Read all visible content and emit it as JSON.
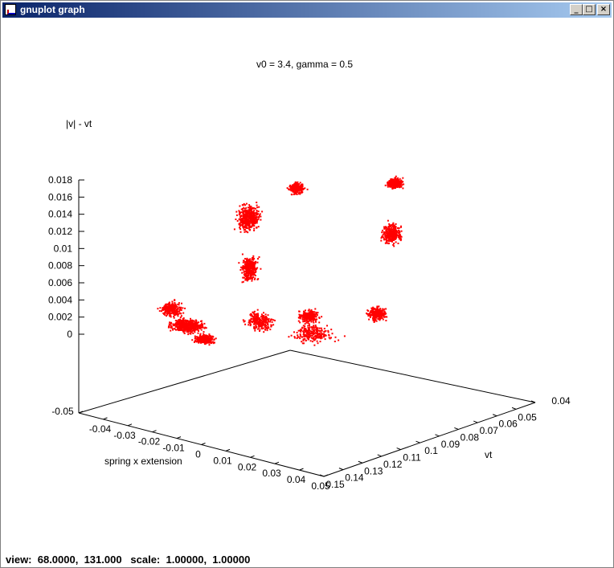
{
  "window": {
    "title": "gnuplot graph",
    "buttons": {
      "minimize": "_",
      "maximize": "□",
      "close": "×"
    }
  },
  "status": {
    "text": "view:  68.0000,  131.000   scale:  1.00000,  1.00000"
  },
  "chart_data": {
    "type": "scatter",
    "title": "v0 = 3.4, gamma = 0.5",
    "xlabel": "spring x extension",
    "ylabel": "vt",
    "zlabel": "|v| - vt",
    "xlim": [
      -0.05,
      0.05
    ],
    "ylim": [
      0.04,
      0.15
    ],
    "zlim": [
      0,
      0.018
    ],
    "grid": false,
    "view": {
      "rot_x": 68,
      "rot_z": 131,
      "scale": 1,
      "scale_z": 1
    },
    "x_ticks": [
      "-0.05",
      "-0.04",
      "-0.03",
      "-0.02",
      "-0.01",
      "0",
      "0.01",
      "0.02",
      "0.03",
      "0.04",
      "0.05"
    ],
    "y_ticks": [
      "0.04",
      "0.05",
      "0.06",
      "0.07",
      "0.08",
      "0.09",
      "0.1",
      "0.11",
      "0.12",
      "0.13",
      "0.14",
      "0.15"
    ],
    "z_ticks": [
      "0",
      "0.002",
      "0.004",
      "0.006",
      "0.008",
      "0.01",
      "0.012",
      "0.014",
      "0.016",
      "0.018"
    ],
    "series_color": "#ff0000",
    "clusters": [
      {
        "x": -0.028,
        "y": 0.122,
        "z": 0.0005,
        "spread": [
          0.007,
          0.006,
          0.0008
        ],
        "count": 520
      },
      {
        "x": -0.04,
        "y": 0.115,
        "z": 0.001,
        "spread": [
          0.004,
          0.005,
          0.001
        ],
        "count": 260
      },
      {
        "x": -0.016,
        "y": 0.128,
        "z": 0.0003,
        "spread": [
          0.004,
          0.004,
          0.0006
        ],
        "count": 300
      },
      {
        "x": -0.02,
        "y": 0.1,
        "z": 0.006,
        "spread": [
          0.003,
          0.004,
          0.002
        ],
        "count": 330
      },
      {
        "x": -0.032,
        "y": 0.085,
        "z": 0.01,
        "spread": [
          0.004,
          0.006,
          0.002
        ],
        "count": 460
      },
      {
        "x": -0.02,
        "y": 0.075,
        "z": 0.0135,
        "spread": [
          0.003,
          0.004,
          0.0008
        ],
        "count": 230
      },
      {
        "x": 0.02,
        "y": 0.075,
        "z": 0.017,
        "spread": [
          0.003,
          0.004,
          0.0007
        ],
        "count": 280
      },
      {
        "x": 0.03,
        "y": 0.09,
        "z": 0.013,
        "spread": [
          0.003,
          0.005,
          0.0015
        ],
        "count": 300
      },
      {
        "x": 0.04,
        "y": 0.11,
        "z": 0.006,
        "spread": [
          0.004,
          0.004,
          0.001
        ],
        "count": 300
      },
      {
        "x": 0.02,
        "y": 0.12,
        "z": 0.005,
        "spread": [
          0.004,
          0.005,
          0.0008
        ],
        "count": 260
      },
      {
        "x": 0.0,
        "y": 0.12,
        "z": 0.003,
        "spread": [
          0.006,
          0.005,
          0.0012
        ],
        "count": 260
      },
      {
        "x": 0.01,
        "y": 0.105,
        "z": 0.001,
        "spread": [
          0.008,
          0.01,
          0.0012
        ],
        "count": 240
      }
    ]
  }
}
